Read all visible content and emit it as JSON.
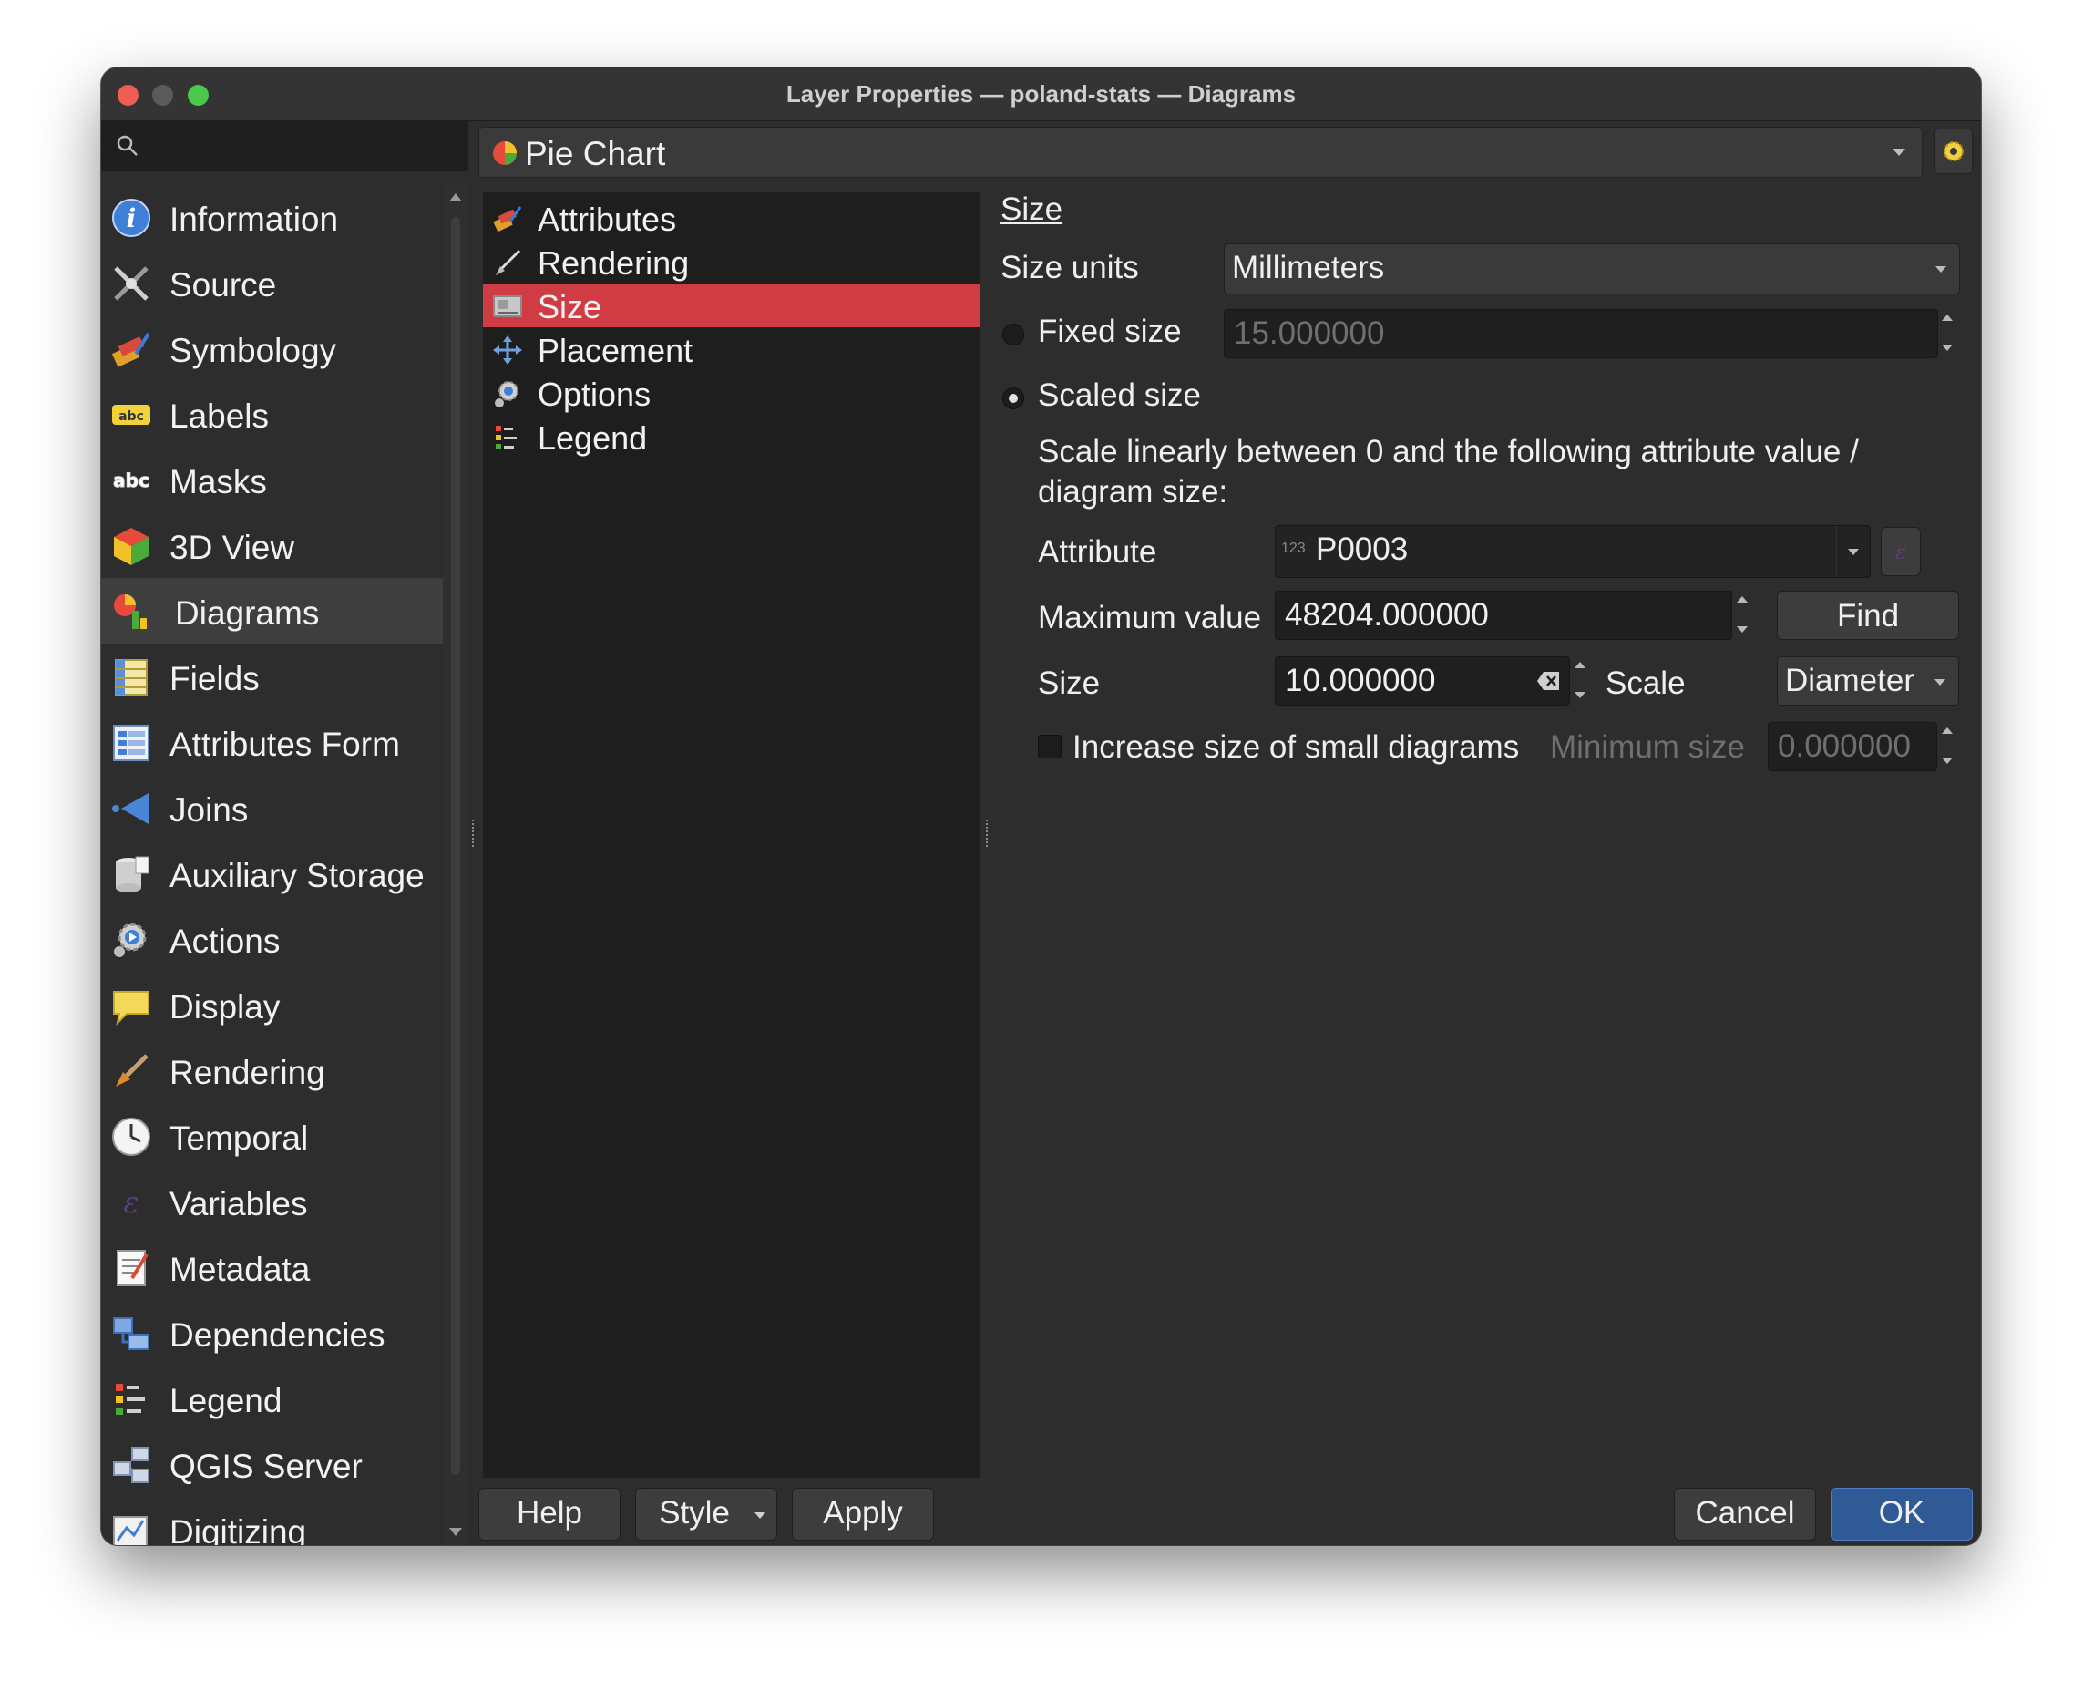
{
  "window": {
    "title": "Layer Properties — poland-stats — Diagrams"
  },
  "sidebar": {
    "search_placeholder": "",
    "items": [
      {
        "label": "Information",
        "icon": "info-icon"
      },
      {
        "label": "Source",
        "icon": "source-icon"
      },
      {
        "label": "Symbology",
        "icon": "symbology-icon"
      },
      {
        "label": "Labels",
        "icon": "labels-icon"
      },
      {
        "label": "Masks",
        "icon": "masks-icon"
      },
      {
        "label": "3D View",
        "icon": "3d-view-icon"
      },
      {
        "label": "Diagrams",
        "icon": "diagrams-icon",
        "selected": true
      },
      {
        "label": "Fields",
        "icon": "fields-icon"
      },
      {
        "label": "Attributes Form",
        "icon": "attributes-form-icon"
      },
      {
        "label": "Joins",
        "icon": "joins-icon"
      },
      {
        "label": "Auxiliary Storage",
        "icon": "auxiliary-storage-icon"
      },
      {
        "label": "Actions",
        "icon": "actions-icon"
      },
      {
        "label": "Display",
        "icon": "display-icon"
      },
      {
        "label": "Rendering",
        "icon": "rendering-icon"
      },
      {
        "label": "Temporal",
        "icon": "temporal-icon"
      },
      {
        "label": "Variables",
        "icon": "variables-icon"
      },
      {
        "label": "Metadata",
        "icon": "metadata-icon"
      },
      {
        "label": "Dependencies",
        "icon": "dependencies-icon"
      },
      {
        "label": "Legend",
        "icon": "legend-icon"
      },
      {
        "label": "QGIS Server",
        "icon": "qgis-server-icon"
      },
      {
        "label": "Digitizing",
        "icon": "digitizing-icon"
      }
    ]
  },
  "diagram_type": {
    "value": "Pie Chart"
  },
  "sublist": {
    "items": [
      {
        "label": "Attributes",
        "icon": "attributes-icon"
      },
      {
        "label": "Rendering",
        "icon": "rendering-brush-icon"
      },
      {
        "label": "Size",
        "icon": "size-icon",
        "selected": true
      },
      {
        "label": "Placement",
        "icon": "placement-icon"
      },
      {
        "label": "Options",
        "icon": "options-icon"
      },
      {
        "label": "Legend",
        "icon": "legend-icon"
      }
    ]
  },
  "size_panel": {
    "section_title": "Size",
    "size_units_label": "Size units",
    "size_units_value": "Millimeters",
    "fixed_size_label": "Fixed size",
    "fixed_size_value": "15.000000",
    "scaled_size_label": "Scaled size",
    "scale_description_line1": "Scale linearly between 0 and the following attribute value /",
    "scale_description_line2": "diagram size:",
    "attribute_label": "Attribute",
    "attribute_type_badge": "123",
    "attribute_value": "P0003",
    "max_value_label": "Maximum value",
    "max_value": "48204.000000",
    "find_button": "Find",
    "size_label": "Size",
    "size_value": "10.000000",
    "scale_label": "Scale",
    "scale_value": "Diameter",
    "increase_small_label": "Increase size of small diagrams",
    "minimum_size_label": "Minimum size",
    "minimum_size_value": "0.000000",
    "scaled_size_checked": true,
    "increase_small_checked": false
  },
  "footer": {
    "help": "Help",
    "style": "Style",
    "apply": "Apply",
    "cancel": "Cancel",
    "ok": "OK"
  },
  "colors": {
    "selection_red": "#d03c43",
    "ok_blue": "#2f5a96",
    "window_bg": "#2d2d2d"
  }
}
